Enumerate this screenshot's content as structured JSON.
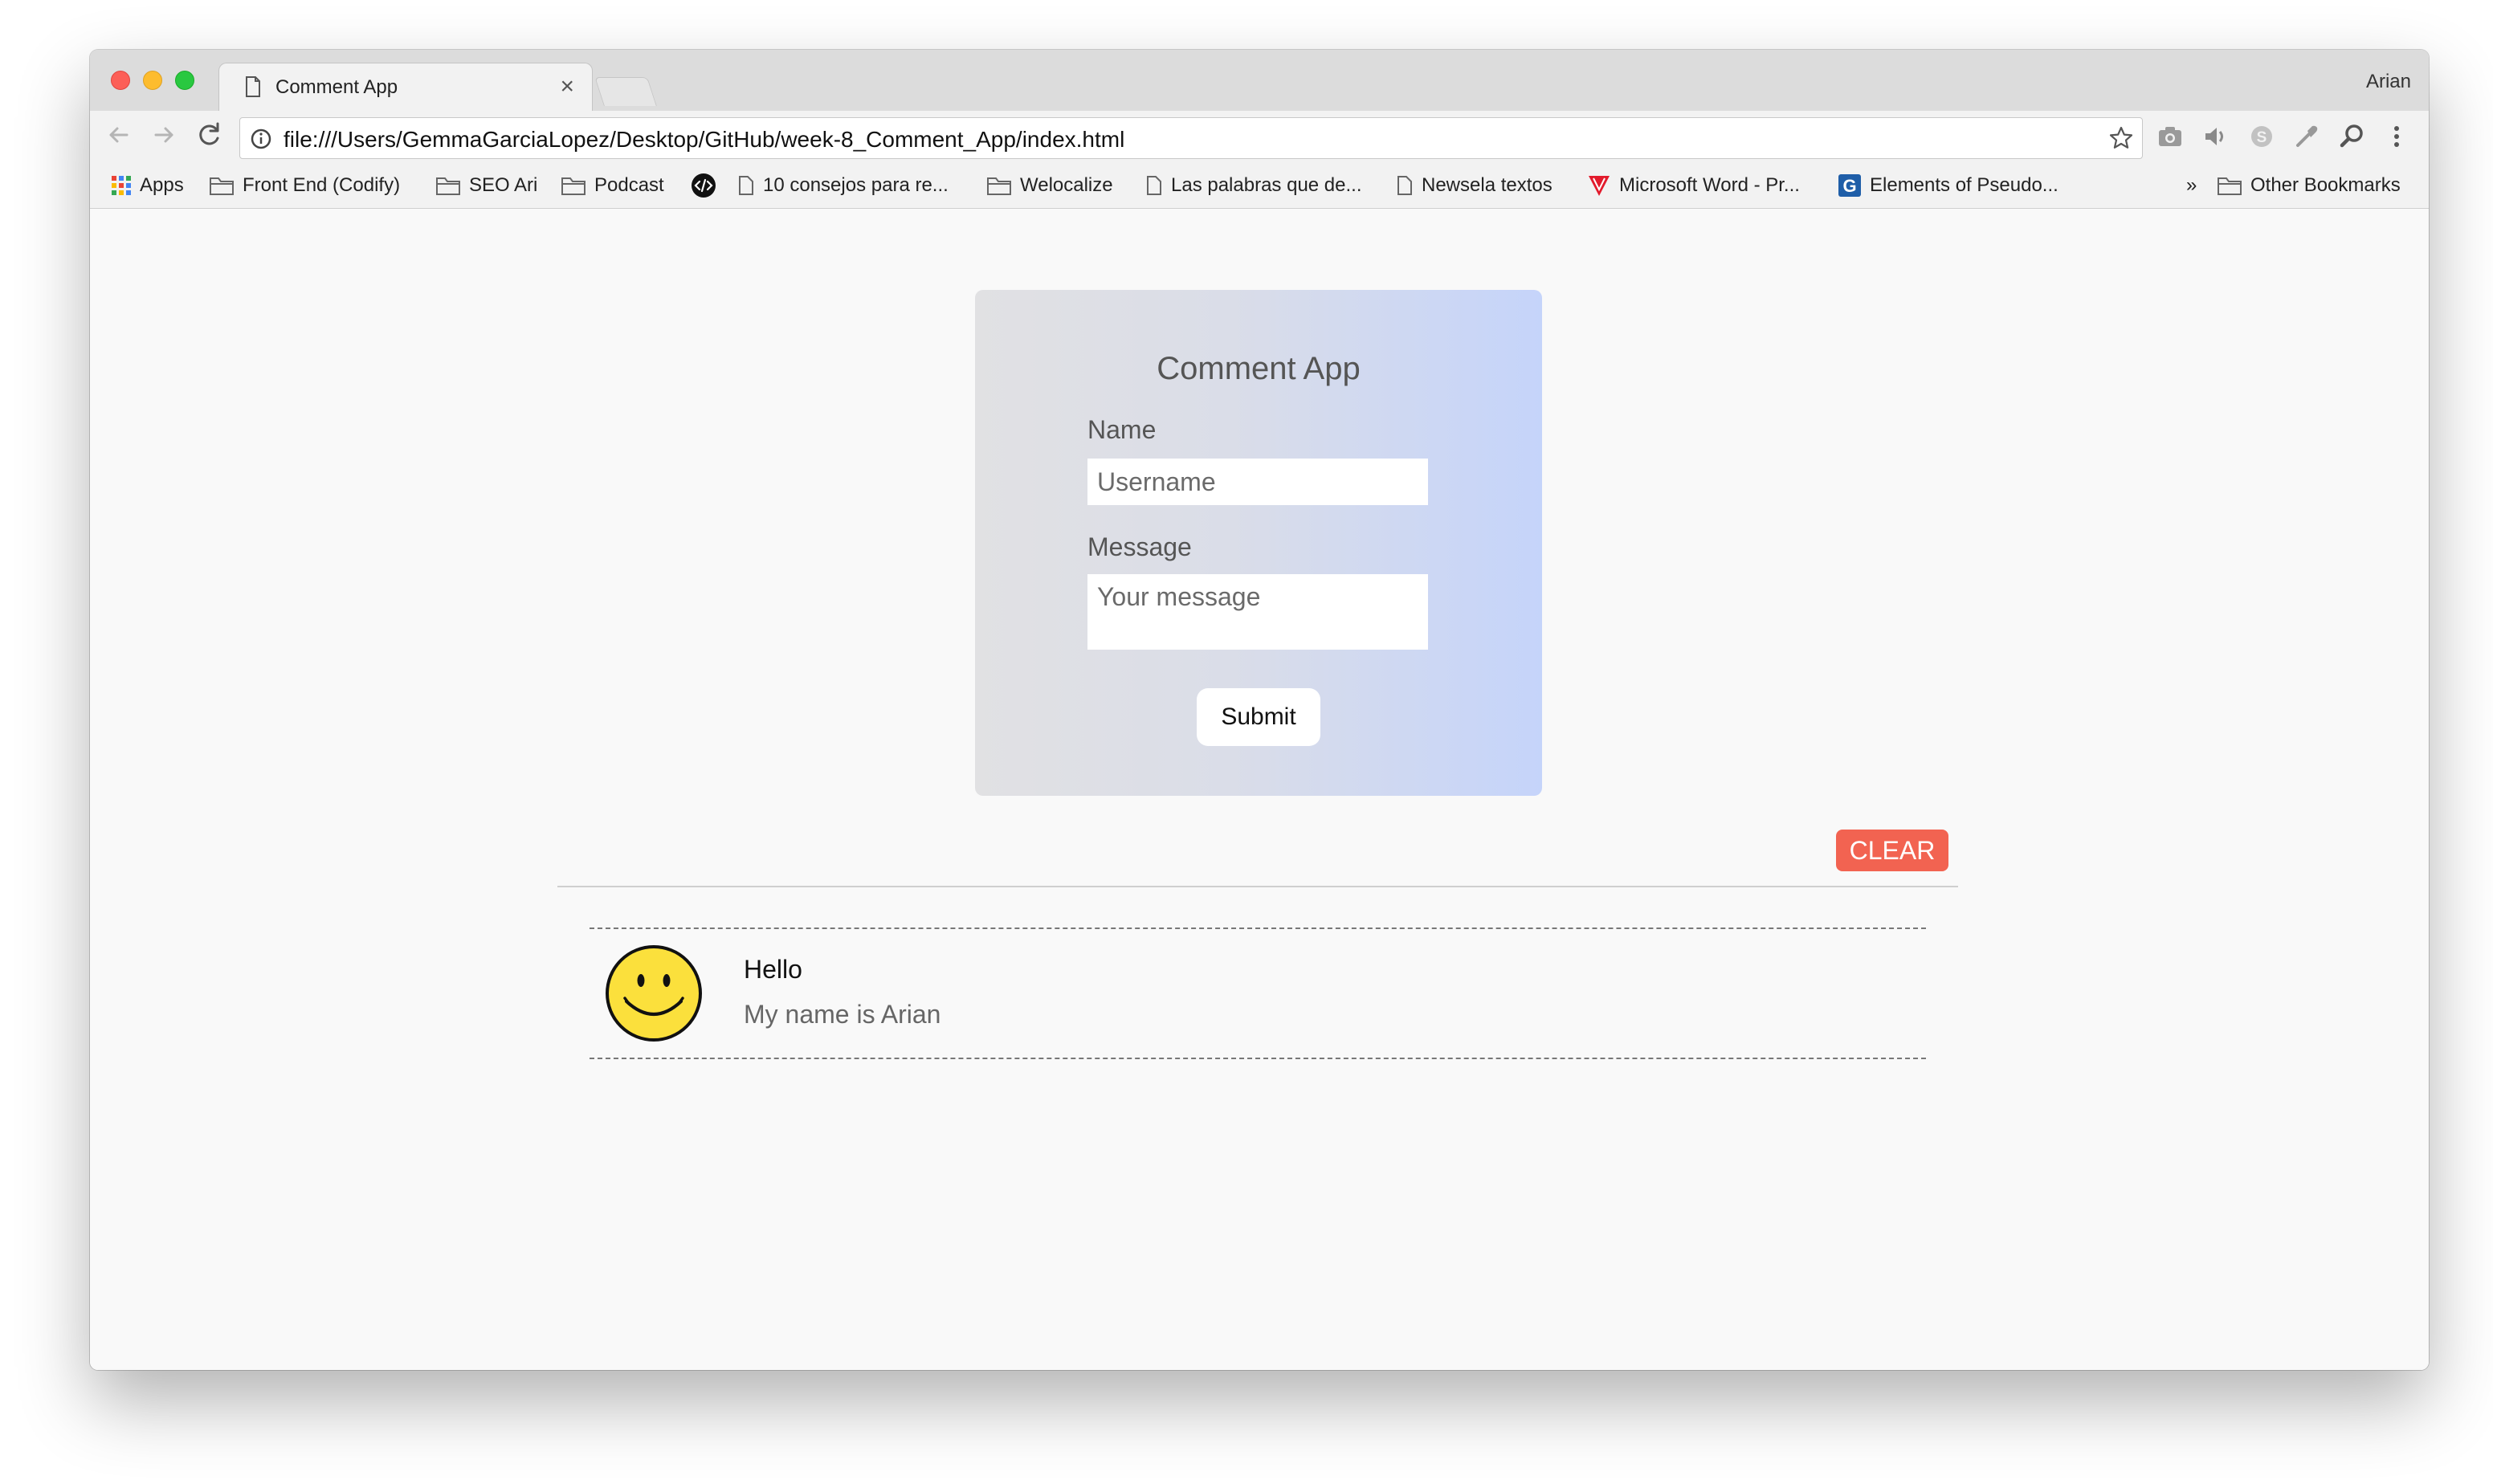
{
  "browser": {
    "tab_title": "Comment App",
    "tab_close": "×",
    "profile_name": "Arian",
    "url": "file:///Users/GemmaGarciaLopez/Desktop/GitHub/week-8_Comment_App/index.html",
    "bookmarks": [
      {
        "label": "Apps",
        "icon": "apps-grid-icon"
      },
      {
        "label": "Front End (Codify)",
        "icon": "folder-icon"
      },
      {
        "label": "SEO Ari",
        "icon": "folder-icon"
      },
      {
        "label": "Podcast",
        "icon": "folder-icon"
      },
      {
        "label": "",
        "icon": "code-icon"
      },
      {
        "label": "10 consejos para re...",
        "icon": "page-icon"
      },
      {
        "label": "Welocalize",
        "icon": "folder-icon"
      },
      {
        "label": "Las palabras que de...",
        "icon": "page-icon"
      },
      {
        "label": "Newsela textos",
        "icon": "page-icon"
      },
      {
        "label": "Microsoft Word - Pr...",
        "icon": "vivaldi-icon"
      },
      {
        "label": "Elements of Pseudo...",
        "icon": "g-icon"
      }
    ],
    "bookmarks_overflow": "»",
    "other_bookmarks": "Other Bookmarks"
  },
  "form": {
    "title": "Comment App",
    "name_label": "Name",
    "name_placeholder": "Username",
    "message_label": "Message",
    "message_placeholder": "Your message",
    "submit_label": "Submit"
  },
  "actions": {
    "clear_label": "CLEAR"
  },
  "comments": [
    {
      "title": "Hello",
      "body": "My name is Arian",
      "avatar": "smiley-face-icon"
    }
  ],
  "colors": {
    "clear_button": "#f26351",
    "card_gradient_start": "#e1e1e3",
    "card_gradient_end": "#c5d4fa",
    "smiley_yellow": "#fbe03c"
  }
}
